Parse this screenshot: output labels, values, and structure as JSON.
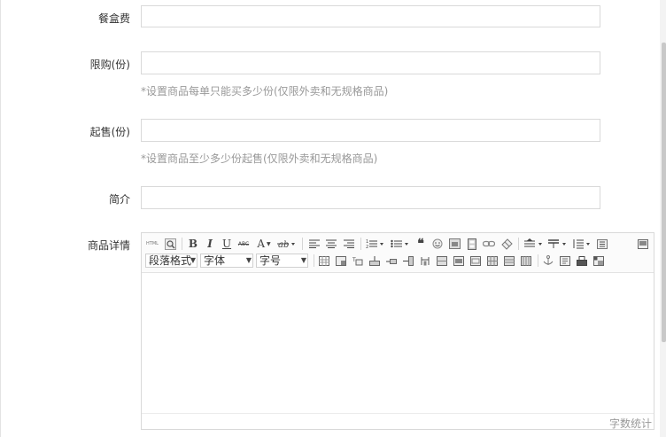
{
  "form": {
    "packing_fee": {
      "label": "餐盒费",
      "value": "",
      "placeholder": ""
    },
    "purchase_limit": {
      "label": "限购(份)",
      "value": "",
      "placeholder": "",
      "hint": "*设置商品每单只能买多少份(仅限外卖和无规格商品)"
    },
    "min_order": {
      "label": "起售(份)",
      "value": "",
      "placeholder": "",
      "hint": "*设置商品至少多少份起售(仅限外卖和无规格商品)"
    },
    "intro": {
      "label": "简介",
      "value": "",
      "placeholder": ""
    },
    "detail": {
      "label": "商品详情",
      "toolbar": {
        "html_label": "HTML",
        "bold": "B",
        "italic": "I",
        "underline": "U",
        "strike": "ABC",
        "font_color": "A",
        "paragraph_select": "段落格式",
        "font_family_select": "字体",
        "font_size_select": "字号"
      },
      "word_count_label": "字数统计"
    }
  },
  "colors": {
    "border": "#d9d9d9",
    "hint": "#999999",
    "toolbar_bg": "#fbfbfb"
  }
}
